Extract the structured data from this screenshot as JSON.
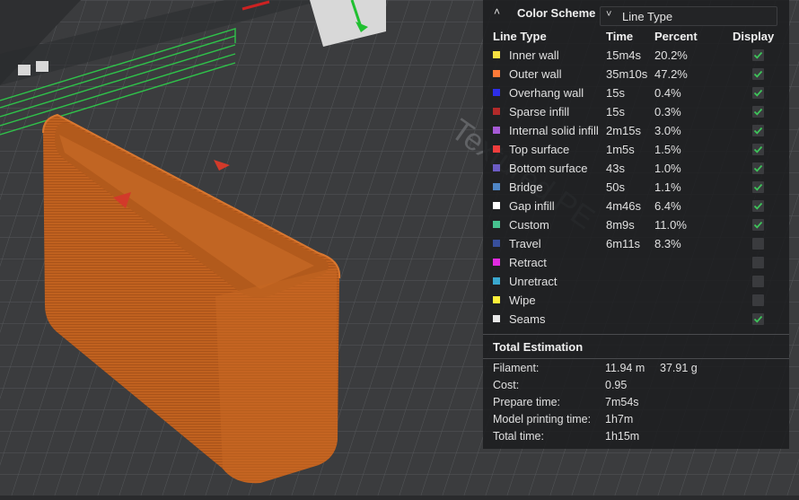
{
  "panel": {
    "title": "Color Scheme",
    "scheme_value": "Line Type",
    "columns": {
      "line_type": "Line Type",
      "time": "Time",
      "percent": "Percent",
      "display": "Display"
    },
    "rows": [
      {
        "label": "Inner wall",
        "time": "15m4s",
        "percent": "20.2%",
        "color": "#f7e041",
        "checked": true
      },
      {
        "label": "Outer wall",
        "time": "35m10s",
        "percent": "47.2%",
        "color": "#ff7a38",
        "checked": true
      },
      {
        "label": "Overhang wall",
        "time": "15s",
        "percent": "0.4%",
        "color": "#2d2ee8",
        "checked": true
      },
      {
        "label": "Sparse infill",
        "time": "15s",
        "percent": "0.3%",
        "color": "#b22a2a",
        "checked": true
      },
      {
        "label": "Internal solid infill",
        "time": "2m15s",
        "percent": "3.0%",
        "color": "#a65ad6",
        "checked": true
      },
      {
        "label": "Top surface",
        "time": "1m5s",
        "percent": "1.5%",
        "color": "#f03d3d",
        "checked": true
      },
      {
        "label": "Bottom surface",
        "time": "43s",
        "percent": "1.0%",
        "color": "#6c5cc4",
        "checked": true
      },
      {
        "label": "Bridge",
        "time": "50s",
        "percent": "1.1%",
        "color": "#4f86c6",
        "checked": true
      },
      {
        "label": "Gap infill",
        "time": "4m46s",
        "percent": "6.4%",
        "color": "#ffffff",
        "checked": true
      },
      {
        "label": "Custom",
        "time": "8m9s",
        "percent": "11.0%",
        "color": "#47c28f",
        "checked": true
      },
      {
        "label": "Travel",
        "time": "6m11s",
        "percent": "8.3%",
        "color": "#384f9c",
        "checked": false
      },
      {
        "label": "Retract",
        "time": "",
        "percent": "",
        "color": "#e12be1",
        "checked": false
      },
      {
        "label": "Unretract",
        "time": "",
        "percent": "",
        "color": "#3aa8cf",
        "checked": false
      },
      {
        "label": "Wipe",
        "time": "",
        "percent": "",
        "color": "#fff03a",
        "checked": false
      },
      {
        "label": "Seams",
        "time": "",
        "percent": "",
        "color": "#e8e8e8",
        "checked": true
      }
    ],
    "total": {
      "title": "Total Estimation",
      "filament_label": "Filament:",
      "filament_length": "11.94 m",
      "filament_weight": "37.91 g",
      "cost_label": "Cost:",
      "cost": "0.95",
      "prepare_label": "Prepare time:",
      "prepare": "7m54s",
      "model_label": "Model printing time:",
      "model": "1h7m",
      "total_label": "Total time:",
      "total": "1h15m"
    },
    "check_color": "#3ec45a"
  },
  "bed": {
    "label": "Textured PE"
  }
}
